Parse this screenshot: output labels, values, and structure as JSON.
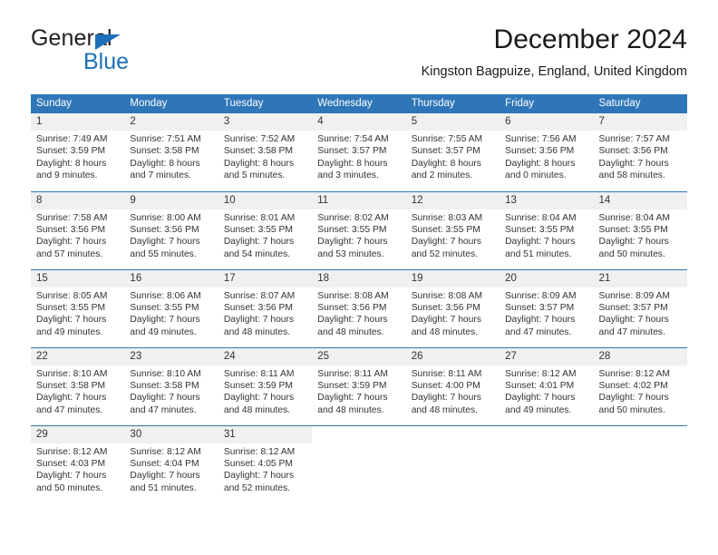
{
  "brand": {
    "name_part1": "General",
    "name_part2": "Blue",
    "flag_icon": "blue-triangle-flag"
  },
  "header": {
    "title": "December 2024",
    "subtitle": "Kingston Bagpuize, England, United Kingdom"
  },
  "colors": {
    "header_blue": "#2f76b8",
    "brand_blue": "#1b70b8",
    "daynum_bg": "#f0f0f0",
    "text": "#333333"
  },
  "weekday_headers": [
    "Sunday",
    "Monday",
    "Tuesday",
    "Wednesday",
    "Thursday",
    "Friday",
    "Saturday"
  ],
  "weeks": [
    [
      {
        "day": "1",
        "sunrise": "Sunrise: 7:49 AM",
        "sunset": "Sunset: 3:59 PM",
        "daylight_line1": "Daylight: 8 hours",
        "daylight_line2": "and 9 minutes."
      },
      {
        "day": "2",
        "sunrise": "Sunrise: 7:51 AM",
        "sunset": "Sunset: 3:58 PM",
        "daylight_line1": "Daylight: 8 hours",
        "daylight_line2": "and 7 minutes."
      },
      {
        "day": "3",
        "sunrise": "Sunrise: 7:52 AM",
        "sunset": "Sunset: 3:58 PM",
        "daylight_line1": "Daylight: 8 hours",
        "daylight_line2": "and 5 minutes."
      },
      {
        "day": "4",
        "sunrise": "Sunrise: 7:54 AM",
        "sunset": "Sunset: 3:57 PM",
        "daylight_line1": "Daylight: 8 hours",
        "daylight_line2": "and 3 minutes."
      },
      {
        "day": "5",
        "sunrise": "Sunrise: 7:55 AM",
        "sunset": "Sunset: 3:57 PM",
        "daylight_line1": "Daylight: 8 hours",
        "daylight_line2": "and 2 minutes."
      },
      {
        "day": "6",
        "sunrise": "Sunrise: 7:56 AM",
        "sunset": "Sunset: 3:56 PM",
        "daylight_line1": "Daylight: 8 hours",
        "daylight_line2": "and 0 minutes."
      },
      {
        "day": "7",
        "sunrise": "Sunrise: 7:57 AM",
        "sunset": "Sunset: 3:56 PM",
        "daylight_line1": "Daylight: 7 hours",
        "daylight_line2": "and 58 minutes."
      }
    ],
    [
      {
        "day": "8",
        "sunrise": "Sunrise: 7:58 AM",
        "sunset": "Sunset: 3:56 PM",
        "daylight_line1": "Daylight: 7 hours",
        "daylight_line2": "and 57 minutes."
      },
      {
        "day": "9",
        "sunrise": "Sunrise: 8:00 AM",
        "sunset": "Sunset: 3:56 PM",
        "daylight_line1": "Daylight: 7 hours",
        "daylight_line2": "and 55 minutes."
      },
      {
        "day": "10",
        "sunrise": "Sunrise: 8:01 AM",
        "sunset": "Sunset: 3:55 PM",
        "daylight_line1": "Daylight: 7 hours",
        "daylight_line2": "and 54 minutes."
      },
      {
        "day": "11",
        "sunrise": "Sunrise: 8:02 AM",
        "sunset": "Sunset: 3:55 PM",
        "daylight_line1": "Daylight: 7 hours",
        "daylight_line2": "and 53 minutes."
      },
      {
        "day": "12",
        "sunrise": "Sunrise: 8:03 AM",
        "sunset": "Sunset: 3:55 PM",
        "daylight_line1": "Daylight: 7 hours",
        "daylight_line2": "and 52 minutes."
      },
      {
        "day": "13",
        "sunrise": "Sunrise: 8:04 AM",
        "sunset": "Sunset: 3:55 PM",
        "daylight_line1": "Daylight: 7 hours",
        "daylight_line2": "and 51 minutes."
      },
      {
        "day": "14",
        "sunrise": "Sunrise: 8:04 AM",
        "sunset": "Sunset: 3:55 PM",
        "daylight_line1": "Daylight: 7 hours",
        "daylight_line2": "and 50 minutes."
      }
    ],
    [
      {
        "day": "15",
        "sunrise": "Sunrise: 8:05 AM",
        "sunset": "Sunset: 3:55 PM",
        "daylight_line1": "Daylight: 7 hours",
        "daylight_line2": "and 49 minutes."
      },
      {
        "day": "16",
        "sunrise": "Sunrise: 8:06 AM",
        "sunset": "Sunset: 3:55 PM",
        "daylight_line1": "Daylight: 7 hours",
        "daylight_line2": "and 49 minutes."
      },
      {
        "day": "17",
        "sunrise": "Sunrise: 8:07 AM",
        "sunset": "Sunset: 3:56 PM",
        "daylight_line1": "Daylight: 7 hours",
        "daylight_line2": "and 48 minutes."
      },
      {
        "day": "18",
        "sunrise": "Sunrise: 8:08 AM",
        "sunset": "Sunset: 3:56 PM",
        "daylight_line1": "Daylight: 7 hours",
        "daylight_line2": "and 48 minutes."
      },
      {
        "day": "19",
        "sunrise": "Sunrise: 8:08 AM",
        "sunset": "Sunset: 3:56 PM",
        "daylight_line1": "Daylight: 7 hours",
        "daylight_line2": "and 48 minutes."
      },
      {
        "day": "20",
        "sunrise": "Sunrise: 8:09 AM",
        "sunset": "Sunset: 3:57 PM",
        "daylight_line1": "Daylight: 7 hours",
        "daylight_line2": "and 47 minutes."
      },
      {
        "day": "21",
        "sunrise": "Sunrise: 8:09 AM",
        "sunset": "Sunset: 3:57 PM",
        "daylight_line1": "Daylight: 7 hours",
        "daylight_line2": "and 47 minutes."
      }
    ],
    [
      {
        "day": "22",
        "sunrise": "Sunrise: 8:10 AM",
        "sunset": "Sunset: 3:58 PM",
        "daylight_line1": "Daylight: 7 hours",
        "daylight_line2": "and 47 minutes."
      },
      {
        "day": "23",
        "sunrise": "Sunrise: 8:10 AM",
        "sunset": "Sunset: 3:58 PM",
        "daylight_line1": "Daylight: 7 hours",
        "daylight_line2": "and 47 minutes."
      },
      {
        "day": "24",
        "sunrise": "Sunrise: 8:11 AM",
        "sunset": "Sunset: 3:59 PM",
        "daylight_line1": "Daylight: 7 hours",
        "daylight_line2": "and 48 minutes."
      },
      {
        "day": "25",
        "sunrise": "Sunrise: 8:11 AM",
        "sunset": "Sunset: 3:59 PM",
        "daylight_line1": "Daylight: 7 hours",
        "daylight_line2": "and 48 minutes."
      },
      {
        "day": "26",
        "sunrise": "Sunrise: 8:11 AM",
        "sunset": "Sunset: 4:00 PM",
        "daylight_line1": "Daylight: 7 hours",
        "daylight_line2": "and 48 minutes."
      },
      {
        "day": "27",
        "sunrise": "Sunrise: 8:12 AM",
        "sunset": "Sunset: 4:01 PM",
        "daylight_line1": "Daylight: 7 hours",
        "daylight_line2": "and 49 minutes."
      },
      {
        "day": "28",
        "sunrise": "Sunrise: 8:12 AM",
        "sunset": "Sunset: 4:02 PM",
        "daylight_line1": "Daylight: 7 hours",
        "daylight_line2": "and 50 minutes."
      }
    ],
    [
      {
        "day": "29",
        "sunrise": "Sunrise: 8:12 AM",
        "sunset": "Sunset: 4:03 PM",
        "daylight_line1": "Daylight: 7 hours",
        "daylight_line2": "and 50 minutes."
      },
      {
        "day": "30",
        "sunrise": "Sunrise: 8:12 AM",
        "sunset": "Sunset: 4:04 PM",
        "daylight_line1": "Daylight: 7 hours",
        "daylight_line2": "and 51 minutes."
      },
      {
        "day": "31",
        "sunrise": "Sunrise: 8:12 AM",
        "sunset": "Sunset: 4:05 PM",
        "daylight_line1": "Daylight: 7 hours",
        "daylight_line2": "and 52 minutes."
      },
      {
        "day": "",
        "sunrise": "",
        "sunset": "",
        "daylight_line1": "",
        "daylight_line2": ""
      },
      {
        "day": "",
        "sunrise": "",
        "sunset": "",
        "daylight_line1": "",
        "daylight_line2": ""
      },
      {
        "day": "",
        "sunrise": "",
        "sunset": "",
        "daylight_line1": "",
        "daylight_line2": ""
      },
      {
        "day": "",
        "sunrise": "",
        "sunset": "",
        "daylight_line1": "",
        "daylight_line2": ""
      }
    ]
  ]
}
